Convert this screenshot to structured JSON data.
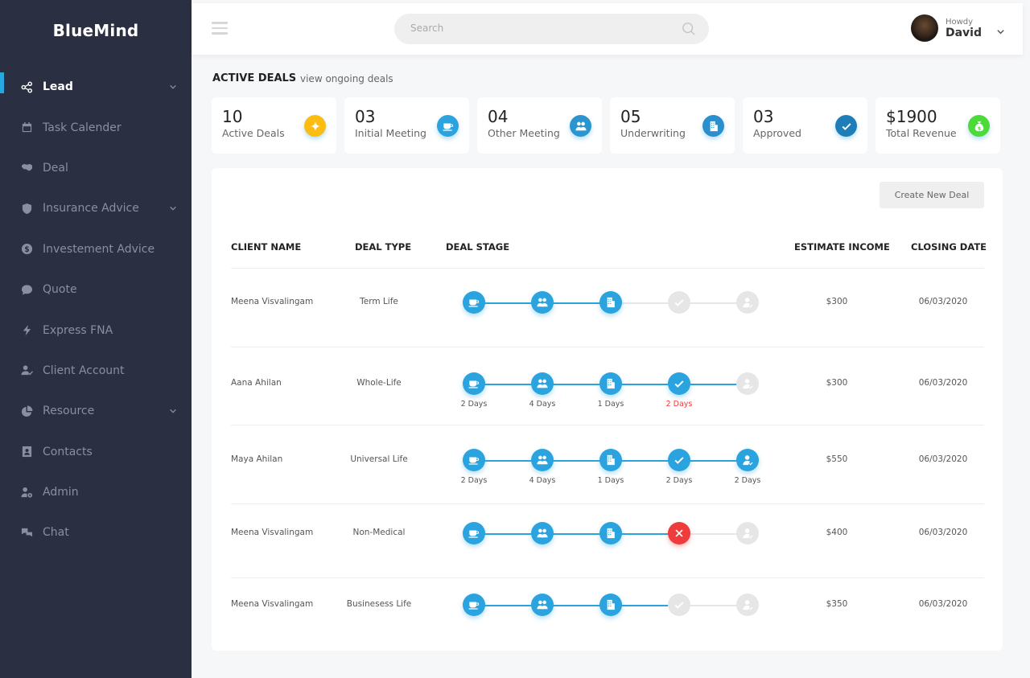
{
  "app": {
    "name": "BlueMind"
  },
  "sidebar": {
    "items": [
      {
        "label": "Lead",
        "icon": "share-nodes-icon",
        "active": true,
        "expandable": true
      },
      {
        "label": "Task Calender",
        "icon": "calendar-icon",
        "active": false,
        "expandable": false
      },
      {
        "label": "Deal",
        "icon": "handshake-icon",
        "active": false,
        "expandable": false
      },
      {
        "label": "Insurance Advice",
        "icon": "shield-icon",
        "active": false,
        "expandable": true
      },
      {
        "label": "Investement Advice",
        "icon": "dollar-badge-icon",
        "active": false,
        "expandable": false
      },
      {
        "label": "Quote",
        "icon": "quote-bubble-icon",
        "active": false,
        "expandable": false
      },
      {
        "label": "Express FNA",
        "icon": "lightning-icon",
        "active": false,
        "expandable": false
      },
      {
        "label": "Client Account",
        "icon": "user-check-icon",
        "active": false,
        "expandable": false
      },
      {
        "label": "Resource",
        "icon": "pie-chart-icon",
        "active": false,
        "expandable": true
      },
      {
        "label": "Contacts",
        "icon": "contact-book-icon",
        "active": false,
        "expandable": false
      },
      {
        "label": "Admin",
        "icon": "user-gear-icon",
        "active": false,
        "expandable": false
      },
      {
        "label": "Chat",
        "icon": "chat-icon",
        "active": false,
        "expandable": false
      }
    ]
  },
  "topbar": {
    "search_placeholder": "Search",
    "greeting": "Howdy",
    "user_name": "David"
  },
  "page": {
    "title": "ACTIVE DEALS",
    "subtitle": "view ongoing deals"
  },
  "stats": [
    {
      "value": "10",
      "label": "Active Deals",
      "icon": "sparkle-icon",
      "color": "#fbbd12"
    },
    {
      "value": "03",
      "label": "Initial Meeting",
      "icon": "coffee-cup-icon",
      "color": "#2aa3de"
    },
    {
      "value": "04",
      "label": "Other Meeting",
      "icon": "users-icon",
      "color": "#2a95cf"
    },
    {
      "value": "05",
      "label": "Underwriting",
      "icon": "building-icon",
      "color": "#2a8fcc"
    },
    {
      "value": "03",
      "label": "Approved",
      "icon": "check-icon",
      "color": "#1f7eb8"
    },
    {
      "value": "$1900",
      "label": "Total Revenue",
      "icon": "money-bag-icon",
      "color": "#4cd93a"
    }
  ],
  "table": {
    "create_button": "Create New Deal",
    "columns": [
      "CLIENT NAME",
      "DEAL TYPE",
      "DEAL STAGE",
      "ESTIMATE INCOME",
      "CLOSING DATE"
    ],
    "stage_icons": [
      "coffee-cup-icon",
      "users-icon",
      "building-icon",
      "check-icon",
      "user-approve-icon"
    ],
    "rows": [
      {
        "client": "Meena Visvalingam",
        "type": "Term Life",
        "income": "$300",
        "date": "06/03/2020",
        "stages": [
          "done",
          "done",
          "done",
          "pending",
          "pending"
        ],
        "links_done": 2,
        "days": []
      },
      {
        "client": "Aana Ahilan",
        "type": "Whole-Life",
        "income": "$300",
        "date": "06/03/2020",
        "stages": [
          "done",
          "done",
          "done",
          "done",
          "pending"
        ],
        "links_done": 4,
        "days": [
          "2 Days",
          "4 Days",
          "1 Days",
          "2 Days"
        ],
        "days_alert_index": 3
      },
      {
        "client": "Maya Ahilan",
        "type": "Universal Life",
        "income": "$550",
        "date": "06/03/2020",
        "stages": [
          "done",
          "done",
          "done",
          "done",
          "done"
        ],
        "links_done": 4,
        "days": [
          "2 Days",
          "4 Days",
          "1 Days",
          "2 Days",
          "2 Days"
        ],
        "days_alert_index": -1
      },
      {
        "client": "Meena Visvalingam",
        "type": "Non-Medical",
        "income": "$400",
        "date": "06/03/2020",
        "stages": [
          "done",
          "done",
          "done",
          "rejected",
          "pending"
        ],
        "links_done": 3,
        "days": []
      },
      {
        "client": "Meena Visvalingam",
        "type": "Businesess Life",
        "income": "$350",
        "date": "06/03/2020",
        "stages": [
          "done",
          "done",
          "done",
          "pending",
          "pending"
        ],
        "links_done": 3,
        "days": []
      }
    ]
  },
  "colors": {
    "accent": "#2aa3de",
    "pending": "#e6e6e6",
    "rejected": "#ee3b3b",
    "sidebar": "#2a2f41"
  }
}
